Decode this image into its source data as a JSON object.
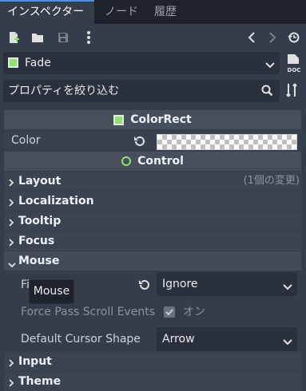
{
  "tabs": [
    {
      "label": "インスペクター",
      "active": true
    },
    {
      "label": "ノード",
      "active": false
    },
    {
      "label": "履歴",
      "active": false
    }
  ],
  "toolbar": {
    "icons": [
      "new-resource-icon",
      "open-folder-icon",
      "save-icon",
      "more-options-icon",
      "history-back-icon",
      "history-forward-icon",
      "object-history-icon"
    ]
  },
  "resource": {
    "name": "Fade",
    "doc_label": "DOC"
  },
  "filter": {
    "placeholder": "プロパティを絞り込む"
  },
  "sections": {
    "colorrect": "ColorRect",
    "control": "Control"
  },
  "color_prop": {
    "label": "Color",
    "value_color": "#ffffff00"
  },
  "categories": {
    "layout": {
      "label": "Layout",
      "note": "(1個の変更)"
    },
    "localization": {
      "label": "Localization"
    },
    "tooltip": {
      "label": "Tooltip"
    },
    "focus": {
      "label": "Focus"
    },
    "mouse": {
      "label": "Mouse"
    },
    "input": {
      "label": "Input"
    },
    "theme": {
      "label": "Theme"
    }
  },
  "mouse_props": {
    "filter": {
      "label": "Fi",
      "value": "Ignore"
    },
    "force_pass": {
      "label": "Force Pass Scroll Events",
      "value": "オン"
    },
    "cursor": {
      "label": "Default Cursor Shape",
      "value": "Arrow"
    }
  },
  "tooltip_popup": {
    "text": "Mouse"
  },
  "colors": {
    "accent": "#4a8fe8",
    "node_green": "#8de36b",
    "background": "#363d4a"
  }
}
